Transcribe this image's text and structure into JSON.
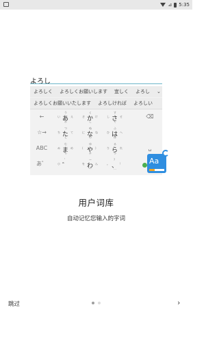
{
  "status_bar": {
    "time": "5:35",
    "wifi_icon": "wifi-icon",
    "battery_icon": "battery-icon",
    "notification_icon": "image-notification-icon"
  },
  "illustration": {
    "input_text": "よろし",
    "candidates_row1": [
      "よろしく",
      "よろしくお願いします",
      "宜しく",
      "よろし",
      "⌄"
    ],
    "candidates_row2": [
      "よろしくお願いいたします",
      "よろしければ",
      "よろしい"
    ],
    "side_keys_left": [
      "←",
      "☆→",
      "ABC",
      "あ゛"
    ],
    "side_keys_right": [
      "⌫",
      "",
      "␣",
      "⏎"
    ],
    "kana_keys": [
      {
        "big": "あ",
        "top": "う",
        "left": "い",
        "right": "え",
        "bottom": "お"
      },
      {
        "big": "か",
        "top": "く",
        "left": "き",
        "right": "け",
        "bottom": "こ"
      },
      {
        "big": "さ",
        "top": "す",
        "left": "し",
        "right": "せ",
        "bottom": "そ"
      },
      {
        "big": "た",
        "top": "つ",
        "left": "ち",
        "right": "て",
        "bottom": "と"
      },
      {
        "big": "な",
        "top": "ぬ",
        "left": "に",
        "right": "ね",
        "bottom": "の"
      },
      {
        "big": "は",
        "top": "ふ",
        "left": "ひ",
        "right": "へ",
        "bottom": "ほ"
      },
      {
        "big": "ま",
        "top": "む",
        "left": "み",
        "right": "め",
        "bottom": "も"
      },
      {
        "big": "や",
        "top": "ゆ",
        "left": "(",
        "right": ")",
        "bottom": "よ"
      },
      {
        "big": "ら",
        "top": "る",
        "left": "り",
        "right": "れ",
        "bottom": "ろ"
      },
      {
        "big": "゛",
        "top": "゜",
        "left": "小",
        "right": "",
        "bottom": ""
      },
      {
        "big": "わ",
        "top": "ー",
        "left": "を",
        "right": "ん",
        "bottom": "～"
      },
      {
        "big": "、",
        "top": "?",
        "left": "。",
        "right": "!",
        "bottom": "…"
      }
    ],
    "dictionary_icon_text": "Aa",
    "colors": {
      "accent": "#2f8ee0",
      "underline": "#6bb6c9",
      "badge_green": "#4caf50",
      "bar_orange": "#f5a623"
    }
  },
  "title": "用户词库",
  "subtitle": "自动记忆您输入的字词",
  "nav": {
    "skip_label": "跳过",
    "next_icon": "chevron-right-icon",
    "page_count": 2,
    "current_page": 1
  }
}
